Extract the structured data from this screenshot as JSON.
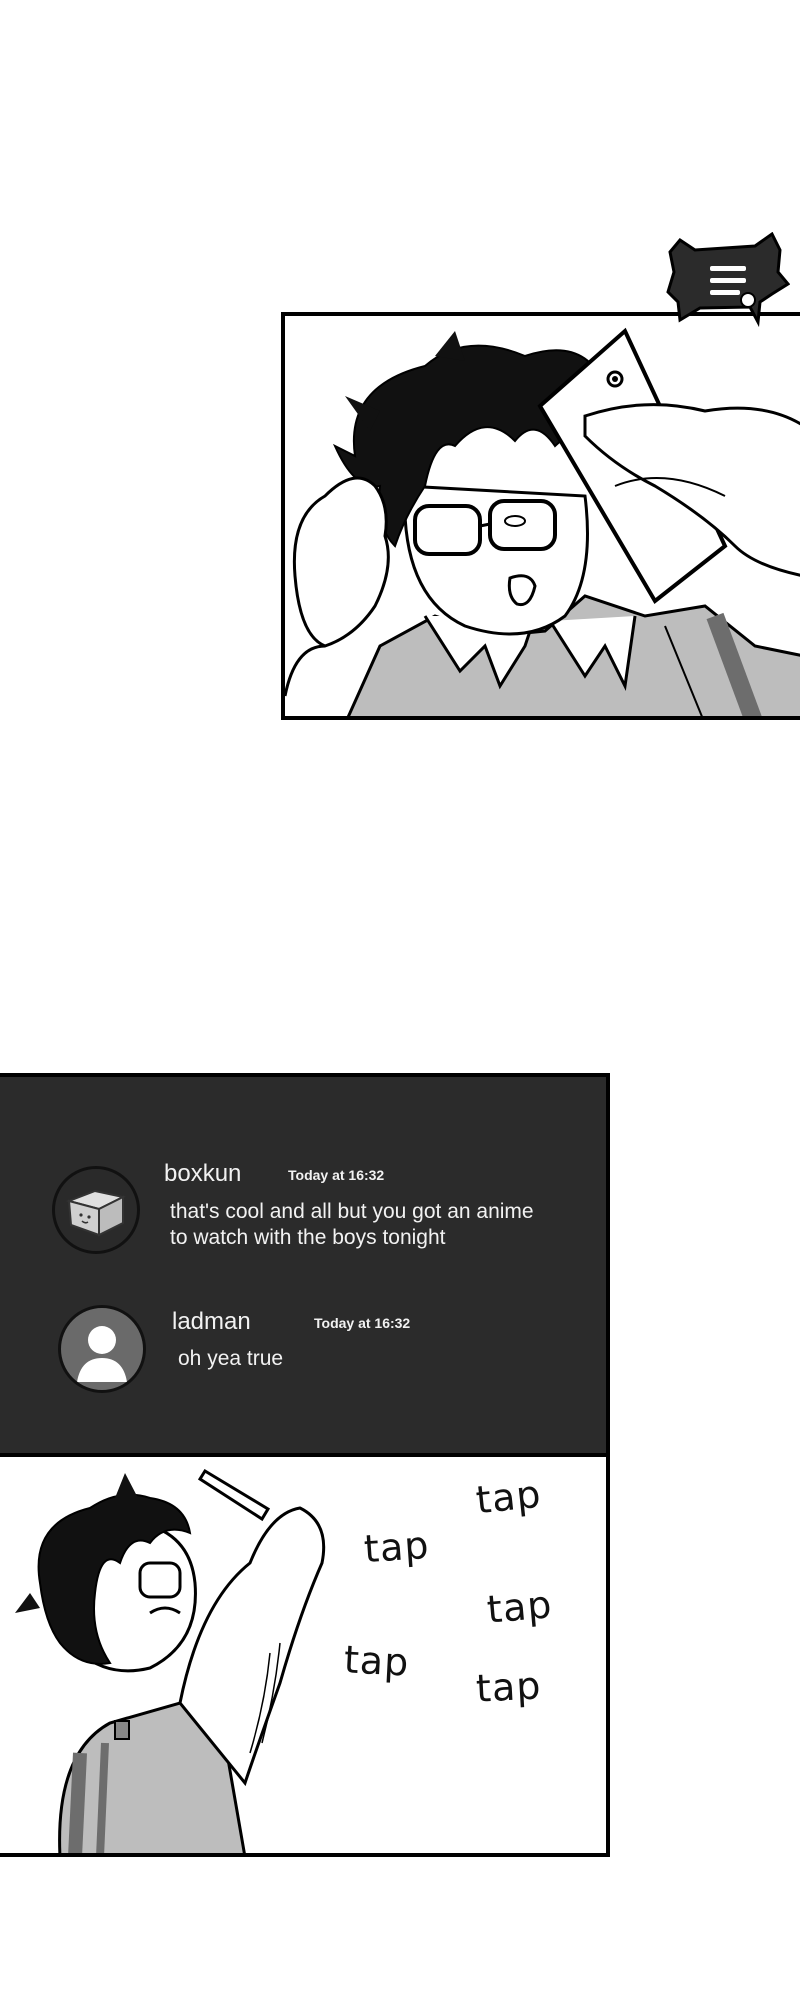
{
  "chat": {
    "messages": [
      {
        "username": "boxkun",
        "timestamp": "Today at 16:32",
        "text": "that's cool and all but you got an anime\nto watch with the boys tonight",
        "avatar_icon": "box-icon"
      },
      {
        "username": "ladman",
        "timestamp": "Today at 16:32",
        "text": "oh yea true",
        "avatar_icon": "default-user-icon"
      }
    ]
  },
  "sfx": {
    "tap1": "tap",
    "tap2": "tap",
    "tap3": "tap",
    "tap4": "tap",
    "tap5": "tap"
  },
  "colors": {
    "chat_background": "#2b2b2b",
    "chat_text": "#f2f2f2",
    "ink": "#000000",
    "shirt_gray": "#bdbdbd"
  }
}
